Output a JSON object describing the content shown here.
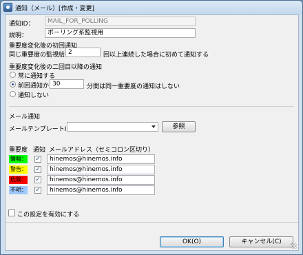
{
  "window": {
    "title": "通知（メール）[作成・変更]"
  },
  "form": {
    "notify_id_label": "通知ID：",
    "notify_id_value": "MAIL_FOR_POLLING",
    "description_label": "説明：",
    "description_value": "ポーリング系監視用"
  },
  "first_notify": {
    "section_title": "重要度変化後の初回通知",
    "prefix": "同じ重要度の監視結果が",
    "count": "2",
    "suffix": "回以上連続した場合に初めて通知する"
  },
  "repeat_notify": {
    "section_title": "重要度変化後の二回目以降の通知",
    "options": [
      {
        "label": "常に通知する",
        "checked": false
      },
      {
        "label": "前回通知から",
        "checked": true
      },
      {
        "label": "通知しない",
        "checked": false
      }
    ],
    "interval_value": "30",
    "interval_suffix": "分間は同一重要度の通知はしない"
  },
  "mail": {
    "section_title": "メール通知",
    "template_label": "メールテンプレートID：",
    "template_value": "",
    "browse_button": "参照",
    "col_priority": "重要度",
    "col_notify": "通知",
    "col_address": "メールアドレス（セミコロン区切り）",
    "rows": [
      {
        "priority": "情報：",
        "color": "#00ff00",
        "checked": true,
        "address": "hinemos@hinemos.info"
      },
      {
        "priority": "警告：",
        "color": "#ffff00",
        "checked": true,
        "address": "hinemos@hinemos.info"
      },
      {
        "priority": "危険：",
        "color": "#ff0000",
        "checked": true,
        "address": "hinemos@hinemos.info"
      },
      {
        "priority": "不明：",
        "color": "#9ec9ff",
        "checked": true,
        "address": "hinemos@hinemos.info"
      }
    ]
  },
  "enable": {
    "label": "この設定を有効にする",
    "checked": false
  },
  "buttons": {
    "ok": "OK(O)",
    "cancel": "キャンセル(C)"
  }
}
